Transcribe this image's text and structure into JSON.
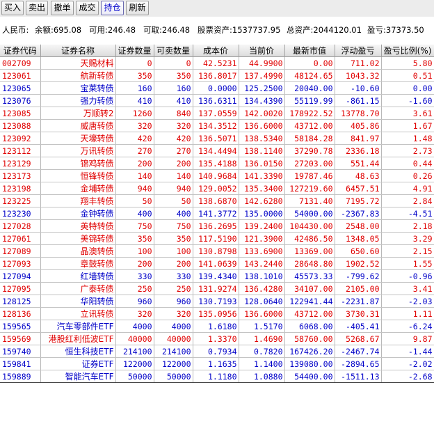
{
  "toolbar": {
    "buttons": [
      {
        "label": "买入"
      },
      {
        "label": "卖出"
      },
      {
        "label": "撤单"
      },
      {
        "label": "成交"
      },
      {
        "label": "持仓",
        "active": true
      },
      {
        "label": "刷新"
      }
    ]
  },
  "summary": {
    "currency": "人民币:",
    "balance": "余额:695.08",
    "available": "可用:246.48",
    "withdrawable": "可取:246.48",
    "stock_assets": "股票资产:1537737.95",
    "total_assets": "总资产:2044120.01",
    "profit_loss": "盈亏:37373.50"
  },
  "columns": [
    "证券代码",
    "证券名称",
    "证券数量",
    "可卖数量",
    "成本价",
    "当前价",
    "最新市值",
    "浮动盈亏",
    "盈亏比例(%)"
  ],
  "rows": [
    {
      "code": "002709",
      "name": "天赐材料",
      "qty": "0",
      "sellable": "0",
      "cost": "42.5231",
      "price": "44.9900",
      "mkt": "0.00",
      "pnl": "711.02",
      "pct": "5.80",
      "dir": "up"
    },
    {
      "code": "123061",
      "name": "航新转债",
      "qty": "350",
      "sellable": "350",
      "cost": "136.8017",
      "price": "137.4990",
      "mkt": "48124.65",
      "pnl": "1043.32",
      "pct": "0.51",
      "dir": "up"
    },
    {
      "code": "123065",
      "name": "宝莱转债",
      "qty": "160",
      "sellable": "160",
      "cost": "0.0000",
      "price": "125.2500",
      "mkt": "20040.00",
      "pnl": "-10.60",
      "pct": "0.00",
      "dir": "down"
    },
    {
      "code": "123076",
      "name": "强力转债",
      "qty": "410",
      "sellable": "410",
      "cost": "136.6311",
      "price": "134.4390",
      "mkt": "55119.99",
      "pnl": "-861.15",
      "pct": "-1.60",
      "dir": "down"
    },
    {
      "code": "123085",
      "name": "万顺转2",
      "qty": "1260",
      "sellable": "840",
      "cost": "137.0559",
      "price": "142.0020",
      "mkt": "178922.52",
      "pnl": "13778.70",
      "pct": "3.61",
      "dir": "up"
    },
    {
      "code": "123088",
      "name": "威唐转债",
      "qty": "320",
      "sellable": "320",
      "cost": "134.3512",
      "price": "136.6000",
      "mkt": "43712.00",
      "pnl": "405.86",
      "pct": "1.67",
      "dir": "up"
    },
    {
      "code": "123092",
      "name": "天壕转债",
      "qty": "420",
      "sellable": "420",
      "cost": "136.5071",
      "price": "138.5340",
      "mkt": "58184.28",
      "pnl": "841.97",
      "pct": "1.48",
      "dir": "up"
    },
    {
      "code": "123112",
      "name": "万讯转债",
      "qty": "270",
      "sellable": "270",
      "cost": "134.4494",
      "price": "138.1140",
      "mkt": "37290.78",
      "pnl": "2336.18",
      "pct": "2.73",
      "dir": "up"
    },
    {
      "code": "123129",
      "name": "锦鸡转债",
      "qty": "200",
      "sellable": "200",
      "cost": "135.4188",
      "price": "136.0150",
      "mkt": "27203.00",
      "pnl": "551.44",
      "pct": "0.44",
      "dir": "up"
    },
    {
      "code": "123173",
      "name": "恒锋转债",
      "qty": "140",
      "sellable": "140",
      "cost": "140.9684",
      "price": "141.3390",
      "mkt": "19787.46",
      "pnl": "48.63",
      "pct": "0.26",
      "dir": "up"
    },
    {
      "code": "123198",
      "name": "金埔转债",
      "qty": "940",
      "sellable": "940",
      "cost": "129.0052",
      "price": "135.3400",
      "mkt": "127219.60",
      "pnl": "6457.51",
      "pct": "4.91",
      "dir": "up"
    },
    {
      "code": "123225",
      "name": "翔丰转债",
      "qty": "50",
      "sellable": "50",
      "cost": "138.6870",
      "price": "142.6280",
      "mkt": "7131.40",
      "pnl": "7195.72",
      "pct": "2.84",
      "dir": "up"
    },
    {
      "code": "123230",
      "name": "金钟转债",
      "qty": "400",
      "sellable": "400",
      "cost": "141.3772",
      "price": "135.0000",
      "mkt": "54000.00",
      "pnl": "-2367.83",
      "pct": "-4.51",
      "dir": "down"
    },
    {
      "code": "127028",
      "name": "英特转债",
      "qty": "750",
      "sellable": "750",
      "cost": "136.2695",
      "price": "139.2400",
      "mkt": "104430.00",
      "pnl": "2548.00",
      "pct": "2.18",
      "dir": "up"
    },
    {
      "code": "127061",
      "name": "美锦转债",
      "qty": "350",
      "sellable": "350",
      "cost": "117.5190",
      "price": "121.3900",
      "mkt": "42486.50",
      "pnl": "1348.05",
      "pct": "3.29",
      "dir": "up"
    },
    {
      "code": "127089",
      "name": "晶澳转债",
      "qty": "100",
      "sellable": "100",
      "cost": "130.8798",
      "price": "133.6900",
      "mkt": "13369.00",
      "pnl": "650.60",
      "pct": "2.15",
      "dir": "up"
    },
    {
      "code": "127093",
      "name": "章鼓转债",
      "qty": "200",
      "sellable": "200",
      "cost": "141.0639",
      "price": "143.2440",
      "mkt": "28648.80",
      "pnl": "1902.52",
      "pct": "1.55",
      "dir": "up"
    },
    {
      "code": "127094",
      "name": "红墙转债",
      "qty": "330",
      "sellable": "330",
      "cost": "139.4340",
      "price": "138.1010",
      "mkt": "45573.33",
      "pnl": "-799.62",
      "pct": "-0.96",
      "dir": "down"
    },
    {
      "code": "127095",
      "name": "广泰转债",
      "qty": "250",
      "sellable": "250",
      "cost": "131.9274",
      "price": "136.4280",
      "mkt": "34107.00",
      "pnl": "2105.00",
      "pct": "3.41",
      "dir": "up"
    },
    {
      "code": "128125",
      "name": "华阳转债",
      "qty": "960",
      "sellable": "960",
      "cost": "130.7193",
      "price": "128.0640",
      "mkt": "122941.44",
      "pnl": "-2231.87",
      "pct": "-2.03",
      "dir": "down"
    },
    {
      "code": "128136",
      "name": "立讯转债",
      "qty": "320",
      "sellable": "320",
      "cost": "135.0956",
      "price": "136.6000",
      "mkt": "43712.00",
      "pnl": "3730.31",
      "pct": "1.11",
      "dir": "up"
    },
    {
      "code": "159565",
      "name": "汽车零部件ETF",
      "qty": "4000",
      "sellable": "4000",
      "cost": "1.6180",
      "price": "1.5170",
      "mkt": "6068.00",
      "pnl": "-405.41",
      "pct": "-6.24",
      "dir": "down"
    },
    {
      "code": "159569",
      "name": "港股红利低波ETF",
      "qty": "40000",
      "sellable": "40000",
      "cost": "1.3370",
      "price": "1.4690",
      "mkt": "58760.00",
      "pnl": "5268.67",
      "pct": "9.87",
      "dir": "up"
    },
    {
      "code": "159740",
      "name": "恒生科技ETF",
      "qty": "214100",
      "sellable": "214100",
      "cost": "0.7934",
      "price": "0.7820",
      "mkt": "167426.20",
      "pnl": "-2467.74",
      "pct": "-1.44",
      "dir": "down"
    },
    {
      "code": "159841",
      "name": "证券ETF",
      "qty": "122000",
      "sellable": "122000",
      "cost": "1.1635",
      "price": "1.1400",
      "mkt": "139080.00",
      "pnl": "-2894.65",
      "pct": "-2.02",
      "dir": "down"
    },
    {
      "code": "159889",
      "name": "智能汽车ETF",
      "qty": "50000",
      "sellable": "50000",
      "cost": "1.1180",
      "price": "1.0880",
      "mkt": "54400.00",
      "pnl": "-1511.13",
      "pct": "-2.68",
      "dir": "down"
    }
  ],
  "colors": {
    "up": "#e00000",
    "down": "#0000c8",
    "active_tab": "#0000cc"
  }
}
